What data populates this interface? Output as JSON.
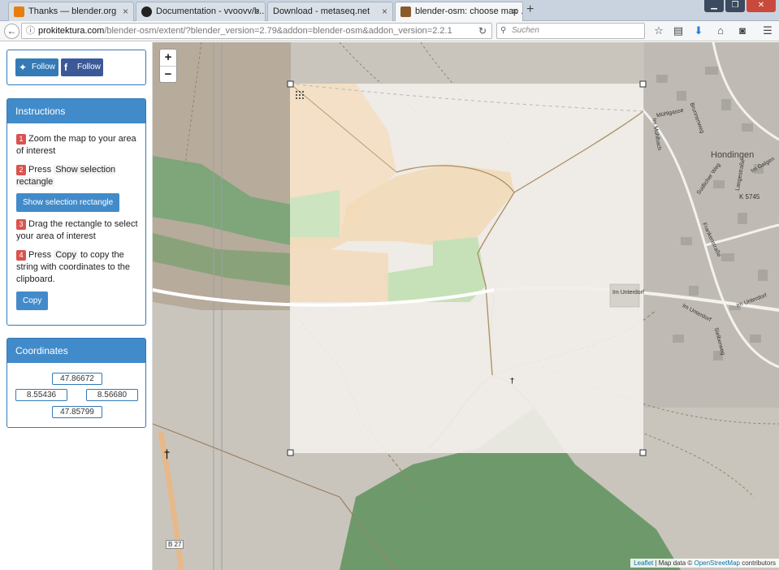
{
  "browser": {
    "tabs": [
      {
        "label": "Thanks — blender.org",
        "icon_color": "#e87d0d"
      },
      {
        "label": "Documentation - vvoovv/b...",
        "icon_color": "#222222"
      },
      {
        "label": "Download - metaseq.net",
        "icon_color": ""
      },
      {
        "label": "blender-osm: choose map ...",
        "icon_color": "#8b5a2b"
      }
    ],
    "url_domain": "prokitektura.com",
    "url_path": "/blender-osm/extent/?blender_version=2.79&addon=blender-osm&addon_version=2.2.1",
    "search_placeholder": "Suchen",
    "newtab_glyph": "+"
  },
  "social": {
    "twitter_label": "Follow",
    "facebook_label": "Follow"
  },
  "instructions": {
    "title": "Instructions",
    "step1_num": "1",
    "step1_text": "Zoom the map to your area of interest",
    "step2_num": "2",
    "step2_pre": "Press",
    "step2_kbd": "Show selection rectangle",
    "show_button": "Show selection rectangle",
    "step3_num": "3",
    "step3_text": "Drag the rectangle to select your area of interest",
    "step4_num": "4",
    "step4_pre": "Press",
    "step4_kbd": "Copy",
    "step4_post": "to copy the string with coordinates to the clipboard.",
    "copy_button": "Copy"
  },
  "coordinates": {
    "title": "Coordinates",
    "north": "47.86672",
    "west": "8.55436",
    "east": "8.56680",
    "south": "47.85799"
  },
  "map": {
    "zoom_in": "+",
    "zoom_out": "−",
    "labels": {
      "town": "Hondingen",
      "road_k": "K 5745",
      "road_b": "B 27",
      "im_unterdorf": "Im Unterdorf",
      "im_unterdorf2": "Im Unterdorf",
      "mulgasse": "Mühlgasse",
      "brunnenweg": "Brunnenweg",
      "im_muhlbach": "Im Mühlbach",
      "sudlicher_weg": "Sudlicher Weg",
      "langestrasse": "Langestraße",
      "im_galgen": "Im Galgen",
      "frankenstrasse": "Frankenstraße",
      "sielberweg": "Sielberweg",
      "im_unterdorf3": "Im Unterdorf"
    },
    "attribution": {
      "leaflet": "Leaflet",
      "mid": " | Map data © ",
      "osm": "OpenStreetMap",
      "end": " contributors"
    }
  }
}
